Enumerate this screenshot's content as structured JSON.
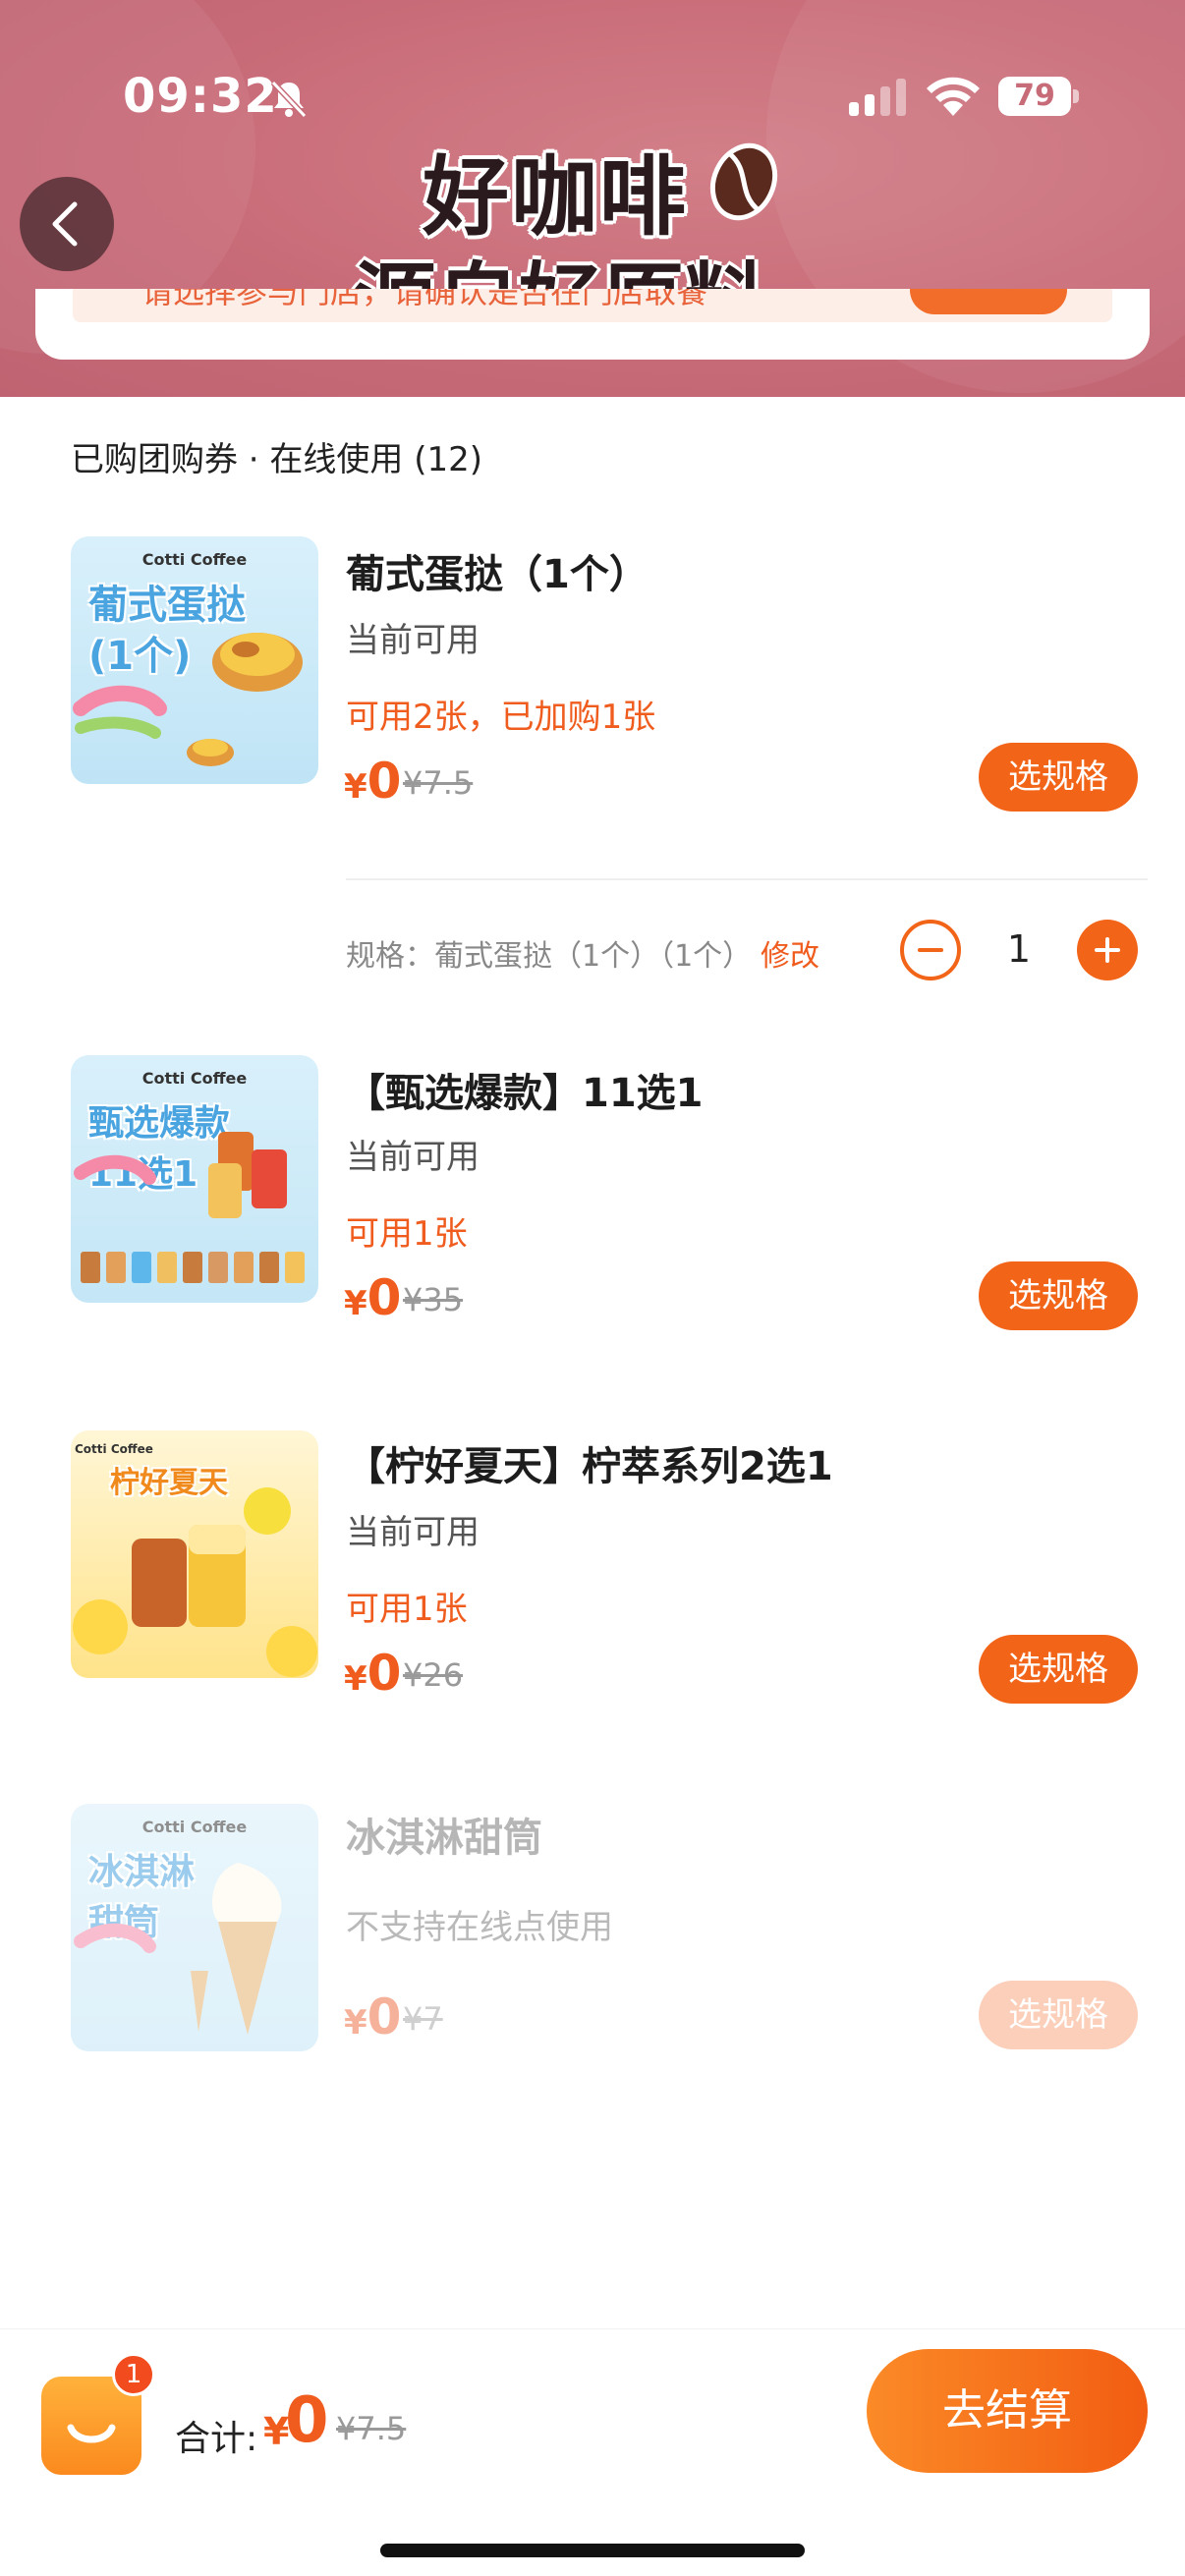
{
  "status_bar": {
    "time": "09:32",
    "battery": "79"
  },
  "banner": {
    "title": "好咖啡",
    "subtitle": "源自好原料"
  },
  "notice": {
    "text": "请选择参与门店，请确认是否在门店取餐"
  },
  "section": {
    "title": "已购团购券 · 在线使用 (12)"
  },
  "items": [
    {
      "name": "葡式蛋挞（1个）",
      "status": "当前可用",
      "availability": "可用2张，已加购1张",
      "currency": "¥",
      "price": "0",
      "original_price": "¥7.5",
      "button": "选规格",
      "thumb_brand": "Cotti Coffee",
      "thumb_title": "葡式蛋挞\n(1个)",
      "spec": "规格：葡式蛋挞（1个）（1个）",
      "edit": "修改",
      "quantity": "1"
    },
    {
      "name": "【甄选爆款】11选1",
      "status": "当前可用",
      "availability": "可用1张",
      "currency": "¥",
      "price": "0",
      "original_price": "¥35",
      "button": "选规格",
      "thumb_brand": "Cotti Coffee",
      "thumb_title": "甄选爆款\n11选1"
    },
    {
      "name": "【柠好夏天】柠萃系列2选1",
      "status": "当前可用",
      "availability": "可用1张",
      "currency": "¥",
      "price": "0",
      "original_price": "¥26",
      "button": "选规格",
      "thumb_brand": "Cotti Coffee",
      "thumb_title": "柠好夏天"
    },
    {
      "name": "冰淇淋甜筒",
      "status": "不支持在线点使用",
      "currency": "¥",
      "price": "0",
      "original_price": "¥7",
      "button": "选规格",
      "thumb_brand": "Cotti Coffee",
      "thumb_title": "冰淇淋\n甜筒"
    }
  ],
  "cart": {
    "badge": "1",
    "total_label": "合计:",
    "currency": "¥",
    "total": "0",
    "original_total": "¥7.5",
    "checkout": "去结算"
  },
  "colors": {
    "accent": "#f26418",
    "header": "#c86b78",
    "price": "#ef5c1e"
  }
}
